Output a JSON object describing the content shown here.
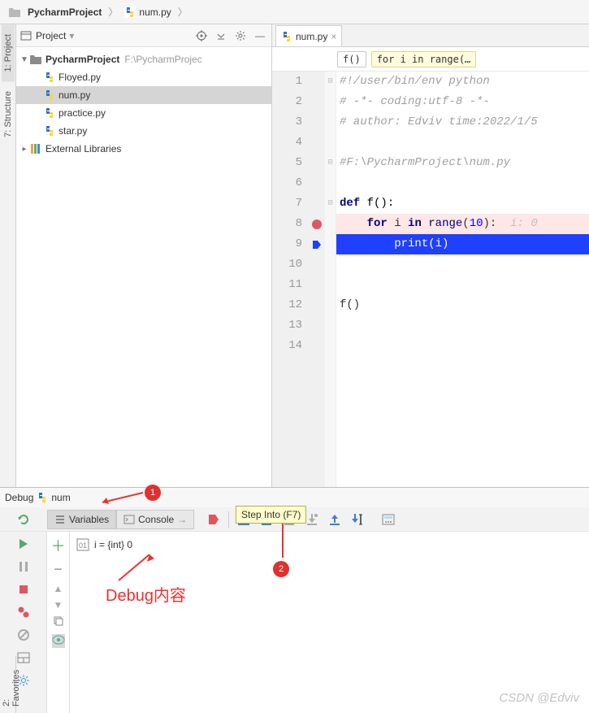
{
  "breadcrumb": {
    "project": "PycharmProject",
    "file": "num.py"
  },
  "sidebar_tabs": {
    "project": "1: Project",
    "structure": "7: Structure",
    "favorites": "2: Favorites"
  },
  "project_panel": {
    "title": "Project",
    "root": "PycharmProject",
    "root_path": "F:\\PycharmProjec",
    "files": [
      "Floyed.py",
      "num.py",
      "practice.py",
      "star.py"
    ],
    "selected": "num.py",
    "external": "External Libraries"
  },
  "editor": {
    "tab": "num.py",
    "crumb_fn": "f()",
    "crumb_loop": "for i in range(…",
    "lines": {
      "1": "#!/user/bin/env python",
      "2": "# -*- coding:utf-8 -*-",
      "3": "# author: Edviv time:2022/1/5",
      "4": "",
      "5": "#F:\\PycharmProject\\num.py",
      "6": "",
      "7_def": "def",
      "7_name": " f():",
      "8_for": "for",
      "8_i": " i ",
      "8_in": "in",
      "8_range": " range",
      "8_p": "(",
      "8_n": "10",
      "8_c": "):",
      "8_inlay": "  i: 0",
      "9_print": "print",
      "9_arg": "(i)",
      "12": "f()"
    },
    "breakpoint_line": 8,
    "exec_line": 9
  },
  "debug": {
    "title": "Debug",
    "run_name": "num",
    "tabs": {
      "variables": "Variables",
      "console": "Console"
    },
    "tooltip": "Step Into (F7)",
    "var_row": "i = {int} 0"
  },
  "annotations": {
    "n1": "1",
    "n2": "2",
    "label": "Debug内容"
  },
  "watermark": "CSDN @Edviv"
}
